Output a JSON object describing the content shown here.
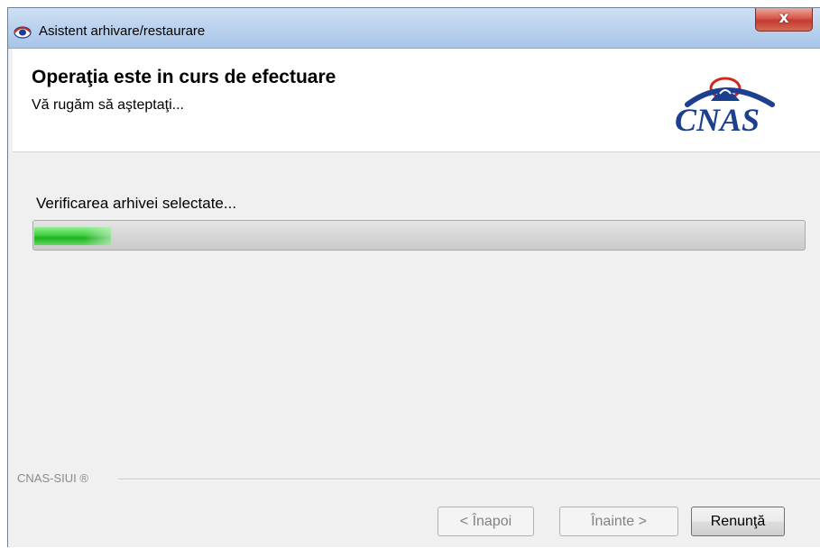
{
  "window": {
    "title": "Asistent arhivare/restaurare",
    "close_glyph": "x"
  },
  "header": {
    "title": "Operaţia este in curs de efectuare",
    "subtitle": "Vă rugăm să aşteptaţi...",
    "logo_text": "CNAS"
  },
  "progress": {
    "label": "Verificarea arhivei selectate...",
    "fraction": 0.1
  },
  "footer": {
    "group_label": "CNAS-SIUI ®"
  },
  "buttons": {
    "back": {
      "label": "< Înapoi",
      "enabled": false
    },
    "next": {
      "label": "Înainte >",
      "enabled": false
    },
    "cancel": {
      "label": "Renunţă",
      "enabled": true
    }
  },
  "colors": {
    "titlebar": "#bcd3ee",
    "progress_green": "#22b022",
    "logo_blue": "#1c3f8f",
    "logo_red": "#d0291e",
    "close_red": "#c13b2e"
  },
  "icons": {
    "app": "cnas-app-icon",
    "close": "close-icon"
  }
}
